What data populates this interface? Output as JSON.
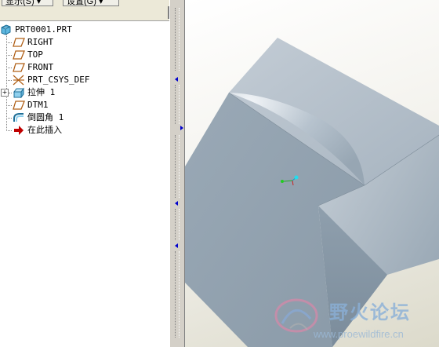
{
  "toolbar": {
    "show_label": "显示(S) ▾",
    "settings_label": "设置(G) ▾"
  },
  "tree": {
    "items": [
      {
        "label": "PRT0001.PRT",
        "icon": "part-icon"
      },
      {
        "label": "RIGHT",
        "icon": "datum-plane-icon"
      },
      {
        "label": "TOP",
        "icon": "datum-plane-icon"
      },
      {
        "label": "FRONT",
        "icon": "datum-plane-icon"
      },
      {
        "label": "PRT_CSYS_DEF",
        "icon": "coordinate-system-icon"
      },
      {
        "label": "拉伸 1",
        "icon": "extrude-icon"
      },
      {
        "label": "DTM1",
        "icon": "datum-plane-icon"
      },
      {
        "label": "倒圆角 1",
        "icon": "round-icon"
      },
      {
        "label": "在此插入",
        "icon": "insert-here-arrow-icon"
      }
    ]
  },
  "watermark": {
    "title": "野火论坛",
    "url": "www.proewildfire.cn"
  },
  "colors": {
    "model_face_light": "#b3c0cb",
    "model_face_mid": "#9aa8b5",
    "model_face_dark": "#7e8e9c",
    "insert_arrow": "#c00000",
    "datum_plane": "#b06018",
    "splitter_arrow": "#0000cc"
  }
}
